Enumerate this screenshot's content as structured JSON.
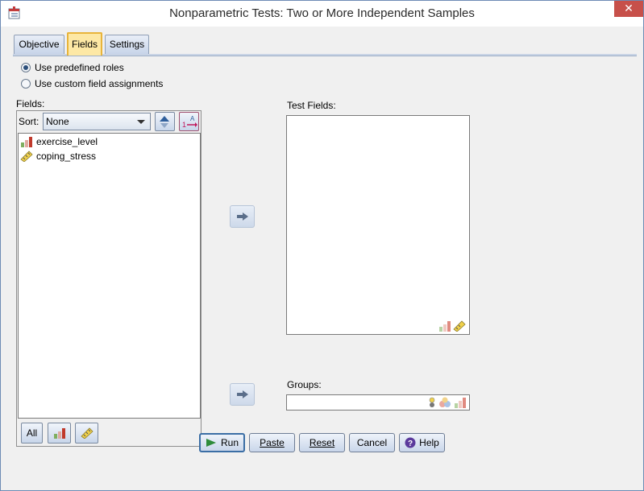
{
  "window": {
    "title": "Nonparametric Tests: Two or More Independent Samples",
    "close_glyph": "✕"
  },
  "tabs": [
    {
      "label": "Objective"
    },
    {
      "label": "Fields"
    },
    {
      "label": "Settings"
    }
  ],
  "roles": {
    "option_predefined": "Use predefined roles",
    "option_custom": "Use custom field assignments",
    "selected": "predefined"
  },
  "fields": {
    "label": "Fields:",
    "sort_label": "Sort:",
    "sort_value": "None",
    "items": [
      {
        "name": "exercise_level",
        "icon": "ordinal-bar-icon"
      },
      {
        "name": "coping_stress",
        "icon": "scale-ruler-icon"
      }
    ],
    "filter_all_label": "All"
  },
  "test_fields": {
    "label": "Test Fields:"
  },
  "groups": {
    "label": "Groups:"
  },
  "buttons": {
    "run": "Run",
    "paste": "Paste",
    "reset": "Reset",
    "cancel": "Cancel",
    "help": "Help"
  },
  "colors": {
    "accent": "#3b6ea5",
    "active_tab": "#fde8a5",
    "close": "#c7504a"
  }
}
